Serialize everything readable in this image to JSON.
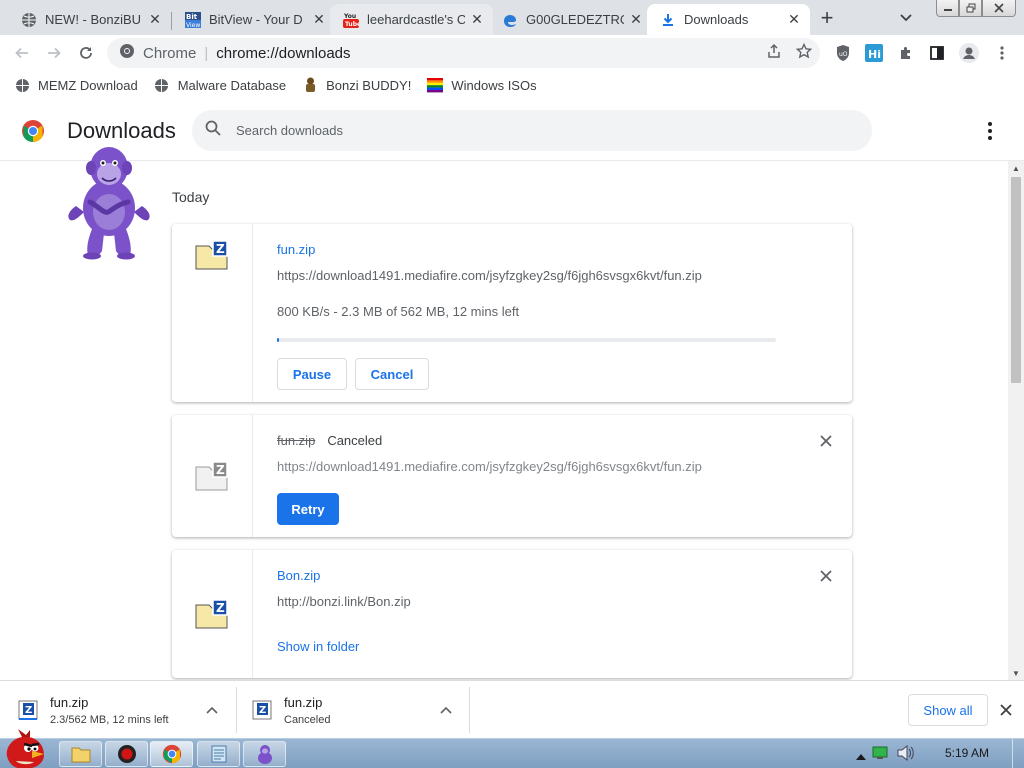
{
  "tabs": [
    {
      "title": "NEW! - BonziBU",
      "icon": "globe-icon"
    },
    {
      "title": "BitView - Your D",
      "icon": "bitview-icon"
    },
    {
      "title": "leehardcastle's C",
      "icon": "youtube-icon"
    },
    {
      "title": "G00GLEDEZTRO",
      "icon": "edge-icon"
    },
    {
      "title": "Downloads",
      "icon": "download-icon"
    }
  ],
  "toolbar": {
    "omnibox_site": "Chrome",
    "omnibox_url": "chrome://downloads"
  },
  "bookmarks": [
    {
      "label": "MEMZ Download",
      "icon": "globe-icon"
    },
    {
      "label": "Malware Database",
      "icon": "globe-icon"
    },
    {
      "label": "Bonzi BUDDY!",
      "icon": "bonzi-icon"
    },
    {
      "label": "Windows ISOs",
      "icon": "windows-icon"
    }
  ],
  "header": {
    "title": "Downloads",
    "search_placeholder": "Search downloads"
  },
  "section_label": "Today",
  "downloads": [
    {
      "name": "fun.zip",
      "url": "https://download1491.mediafire.com/jsyfzgkey2sg/f6jgh6svsgx6kvt/fun.zip",
      "progress_text": "800 KB/s - 2.3 MB of 562 MB, 12 mins left",
      "progress_fraction": 0.004,
      "pause_label": "Pause",
      "cancel_label": "Cancel"
    },
    {
      "name": "fun.zip",
      "status": "Canceled",
      "url": "https://download1491.mediafire.com/jsyfzgkey2sg/f6jgh6svsgx6kvt/fun.zip",
      "retry_label": "Retry"
    },
    {
      "name": "Bon.zip",
      "url": "http://bonzi.link/Bon.zip",
      "show_label": "Show in folder"
    }
  ],
  "shelf": {
    "items": [
      {
        "name": "fun.zip",
        "status": "2.3/562 MB, 12 mins left"
      },
      {
        "name": "fun.zip",
        "status": "Canceled"
      }
    ],
    "show_all_label": "Show all"
  },
  "taskbar": {
    "clock": "5:19 AM"
  },
  "colors": {
    "accent": "#1a73e8",
    "tabstrip": "#dee1e6"
  }
}
